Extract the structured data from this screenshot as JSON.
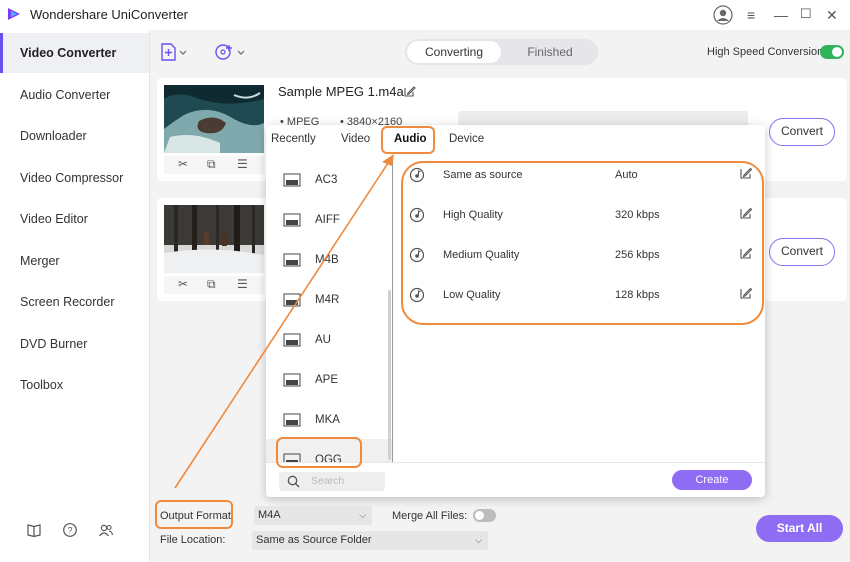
{
  "app": {
    "title": "Wondershare UniConverter"
  },
  "sidebar": {
    "items": [
      {
        "label": "Video Converter",
        "active": true
      },
      {
        "label": "Audio Converter"
      },
      {
        "label": "Downloader"
      },
      {
        "label": "Video Compressor"
      },
      {
        "label": "Video Editor"
      },
      {
        "label": "Merger"
      },
      {
        "label": "Screen Recorder"
      },
      {
        "label": "DVD Burner"
      },
      {
        "label": "Toolbox"
      }
    ]
  },
  "toolbar": {
    "tabs": [
      "Converting",
      "Finished"
    ],
    "active_tab": "Converting",
    "high_speed_label": "High Speed Conversion",
    "high_speed_on": true
  },
  "files": [
    {
      "name": "Sample MPEG 1.m4a",
      "format": "MPEG",
      "resolution": "3840×2160",
      "convert_label": "Convert"
    },
    {
      "convert_label": "Convert"
    }
  ],
  "format_popup": {
    "tabs": [
      "Recently",
      "Video",
      "Audio",
      "Device"
    ],
    "active_tab": "Audio",
    "formats": [
      "AC3",
      "AIFF",
      "M4B",
      "M4R",
      "AU",
      "APE",
      "MKA",
      "OGG"
    ],
    "selected_format": "OGG",
    "qualities": [
      {
        "name": "Same as source",
        "value": "Auto"
      },
      {
        "name": "High Quality",
        "value": "320 kbps"
      },
      {
        "name": "Medium Quality",
        "value": "256 kbps"
      },
      {
        "name": "Low Quality",
        "value": "128 kbps"
      }
    ],
    "search_placeholder": "Search",
    "create_label": "Create"
  },
  "bottom": {
    "output_format_label": "Output Format:",
    "output_format_value": "M4A",
    "merge_label": "Merge All Files:",
    "merge_on": false,
    "file_location_label": "File Location:",
    "file_location_value": "Same as Source Folder",
    "start_all_label": "Start All"
  },
  "colors": {
    "accent": "#8f6cf4",
    "annotation": "#f08a3c",
    "toggle_on": "#2fb45c"
  }
}
